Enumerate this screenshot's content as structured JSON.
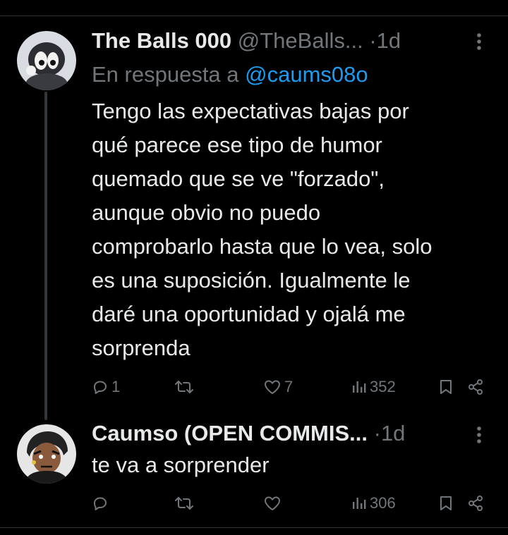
{
  "tweets": [
    {
      "display_name": "The Balls 000",
      "handle": "@TheBalls...",
      "separator": "·",
      "time": "1d",
      "reply_prefix": "En respuesta a ",
      "reply_mention": "@caums08o",
      "text": "Tengo las expectativas bajas por qué parece ese tipo de humor quemado que se ve \"forzado\", aunque obvio no puedo comprobarlo hasta que lo vea, solo es una suposición. Igualmente le daré una oportunidad y ojalá me sorprenda",
      "text_lines": [
        "Tengo las expectativas bajas por",
        "qué parece ese tipo de humor",
        "quemado que se ve \"forzado\",",
        "aunque obvio no puedo",
        "comprobarlo hasta que lo vea, solo",
        "es una suposición. Igualmente le",
        "daré una oportunidad y ojalá me",
        "sorprenda"
      ],
      "replies": "1",
      "retweets": "",
      "likes": "7",
      "views": "352"
    },
    {
      "display_name": "Caumso (OPEN COMMIS...",
      "separator": "·",
      "time": "1d",
      "text": "te va a sorprender",
      "replies": "",
      "retweets": "",
      "likes": "",
      "views": "306"
    }
  ],
  "icons": {
    "more": "more-vertical-icon",
    "reply": "reply-icon",
    "retweet": "retweet-icon",
    "like": "heart-icon",
    "views": "views-icon",
    "bookmark": "bookmark-icon",
    "share": "share-icon"
  },
  "colors": {
    "background": "#000000",
    "text": "#e7e9ea",
    "secondary": "#71767b",
    "link": "#1d9bf0",
    "divider": "#2f3336"
  }
}
